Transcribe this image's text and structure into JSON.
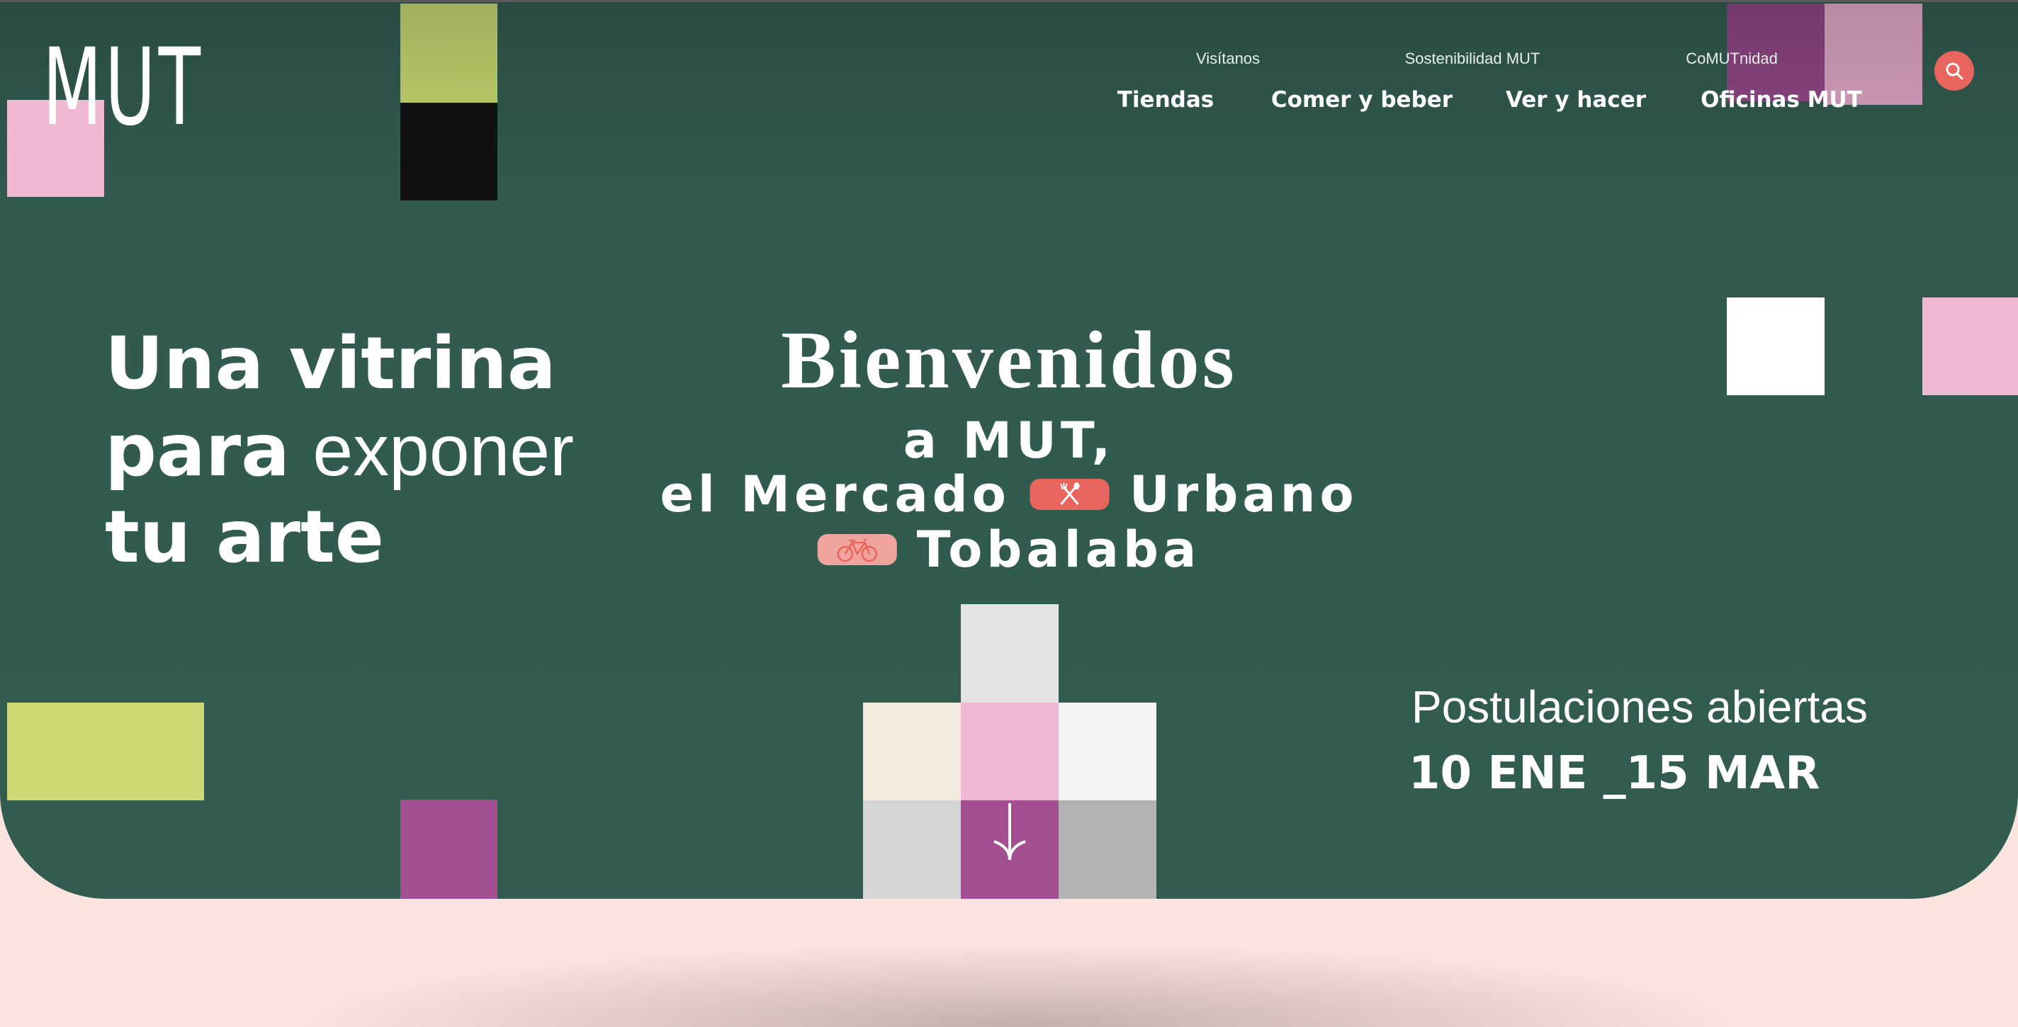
{
  "brand": {
    "logo_text": "MUT"
  },
  "nav": {
    "secondary": [
      "Visítanos",
      "Sostenibilidad MUT",
      "CoMUTnidad"
    ],
    "primary": [
      "Tiendas",
      "Comer y beber",
      "Ver y hacer",
      "Oficinas MUT"
    ],
    "search_icon": "search-icon"
  },
  "hero": {
    "tagline": {
      "part1": "Una vitrina",
      "part2_bold": "para",
      "part2_light": "exponer",
      "part3": "tu arte"
    },
    "welcome": {
      "title": "Bienvenidos",
      "line1": "a MUT,",
      "line2_a": "el Mercado",
      "line2_b": "Urbano",
      "line3": "Tobalaba",
      "icons": [
        "fork-spoon-icon",
        "bicycle-icon"
      ]
    },
    "applications": {
      "label": "Postulaciones abiertas",
      "dates": "10 ENE _15 MAR"
    },
    "scroll_icon": "arrow-down-icon"
  },
  "colors": {
    "hero_bg": "#335c51",
    "page_bg": "#fbe4dd",
    "accent_red": "#e8655d",
    "pink": "#efb9d3",
    "lime": "#cdd974",
    "magenta": "#a44f92"
  }
}
